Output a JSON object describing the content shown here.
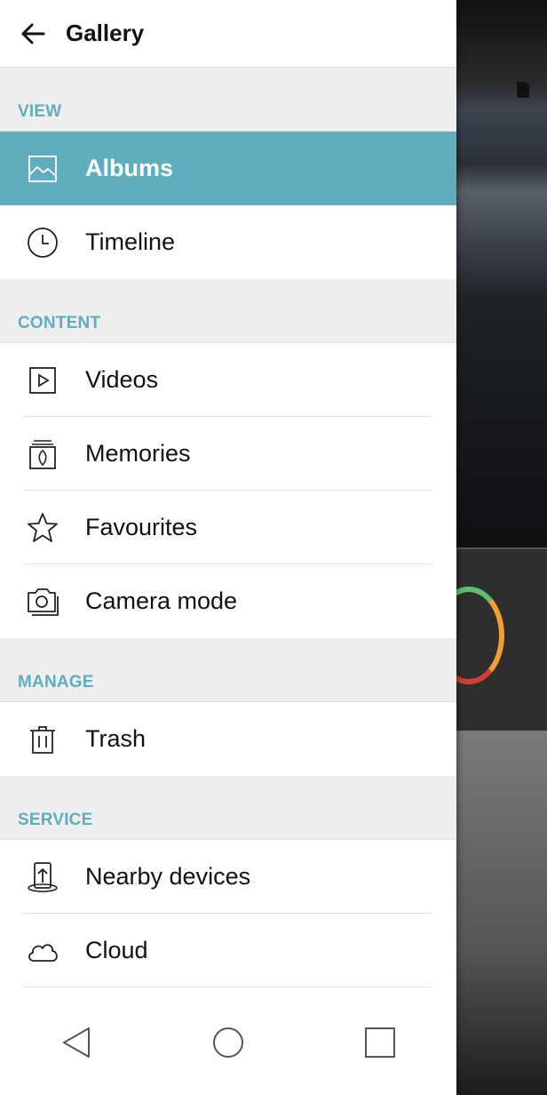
{
  "header": {
    "title": "Gallery"
  },
  "sections": {
    "view": "VIEW",
    "content": "CONTENT",
    "manage": "MANAGE",
    "service": "SERVICE"
  },
  "items": {
    "albums": "Albums",
    "timeline": "Timeline",
    "videos": "Videos",
    "memories": "Memories",
    "favourites": "Favourites",
    "camera_mode": "Camera mode",
    "trash": "Trash",
    "nearby_devices": "Nearby devices",
    "cloud": "Cloud"
  },
  "selected_item": "albums",
  "colors": {
    "accent": "#5faebf",
    "section_bg": "#eeeeee"
  },
  "icons": [
    "back-arrow-icon",
    "image-icon",
    "clock-icon",
    "play-icon",
    "memories-icon",
    "star-icon",
    "camera-icon",
    "trash-icon",
    "share-upload-icon",
    "cloud-icon",
    "nav-back-icon",
    "nav-home-icon",
    "nav-recents-icon"
  ]
}
